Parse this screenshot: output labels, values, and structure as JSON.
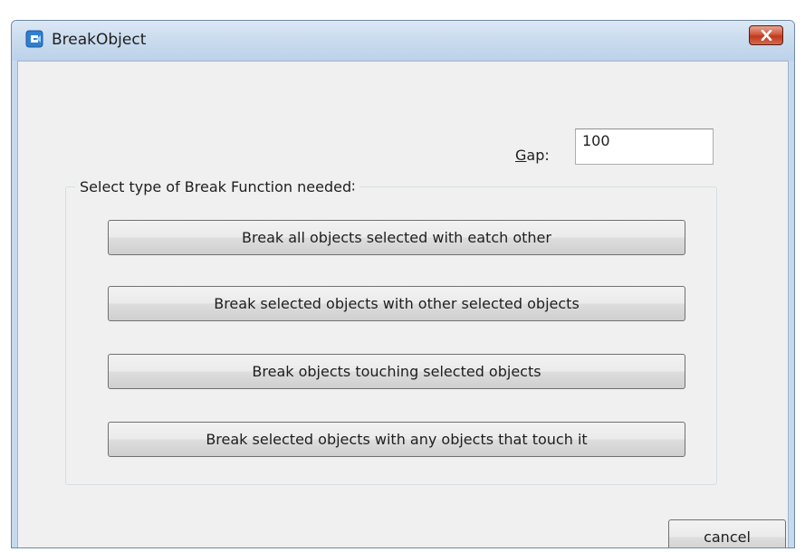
{
  "window": {
    "title": "BreakObject"
  },
  "gap": {
    "label_accel": "G",
    "label_rest": "ap:",
    "value": "100"
  },
  "group": {
    "legend": "Select type of Break Function needed∶"
  },
  "buttons": [
    {
      "label": "Break all objects selected with eatch other"
    },
    {
      "label": "Break selected objects with other selected objects"
    },
    {
      "label": "Break objects touching selected objects"
    },
    {
      "label": "Break selected objects with any objects that touch it"
    }
  ],
  "cancel": {
    "label": "cancel"
  },
  "colors": {
    "titlebar": "#c9dbee",
    "client_bg": "#f0f0f0",
    "close_button": "#c0391c"
  }
}
